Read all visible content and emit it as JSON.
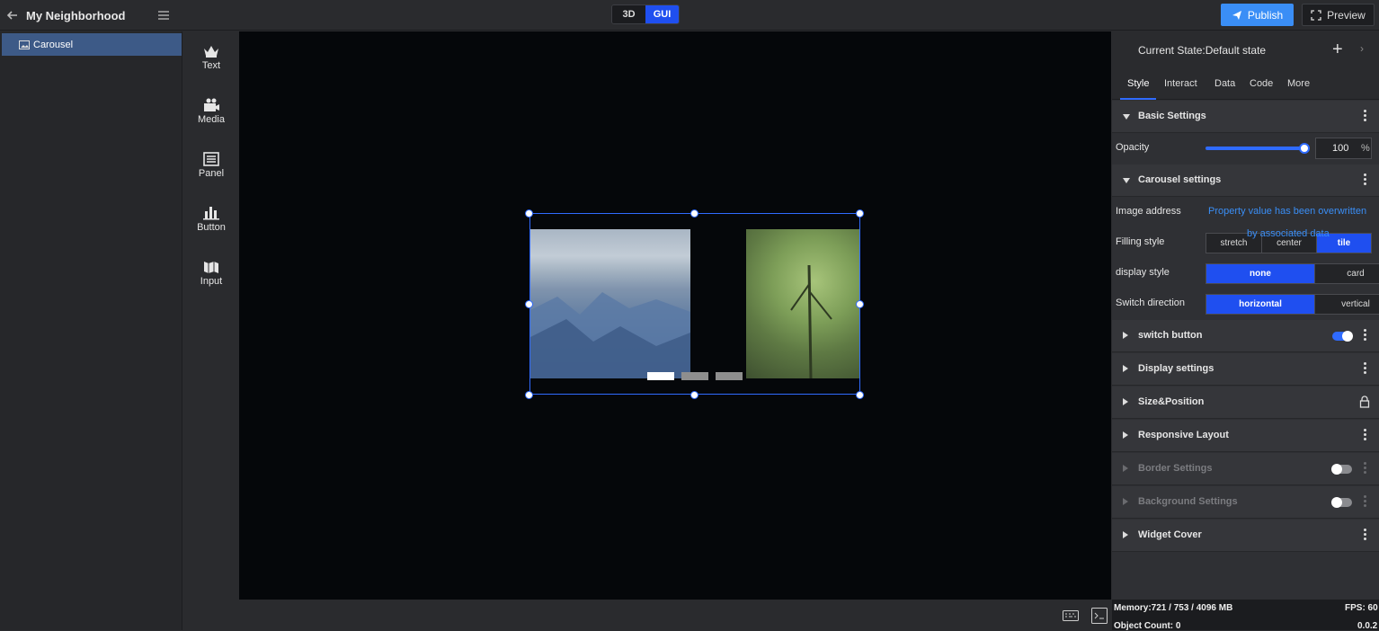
{
  "header": {
    "project_title": "My Neighborhood",
    "mode_3d": "3D",
    "mode_gui": "GUI",
    "publish_label": "Publish",
    "preview_label": "Preview"
  },
  "layers": {
    "items": [
      {
        "label": "Carousel",
        "selected": true
      }
    ]
  },
  "widgets": {
    "items": [
      {
        "label": "Text",
        "icon": "crown-icon"
      },
      {
        "label": "Media",
        "icon": "camera-icon"
      },
      {
        "label": "Panel",
        "icon": "panel-icon"
      },
      {
        "label": "Button",
        "icon": "chart-bars-icon"
      },
      {
        "label": "Input",
        "icon": "map-icon"
      }
    ]
  },
  "canvas": {
    "carousel_indicators": 3,
    "active_indicator": 1
  },
  "props": {
    "state_label": "Current State:Default state",
    "tabs": [
      "Style",
      "Interact",
      "Data",
      "Code",
      "More"
    ],
    "active_tab": "Style",
    "basic_settings": {
      "title": "Basic Settings",
      "opacity_label": "Opacity",
      "opacity_value": "100",
      "opacity_unit": "%",
      "opacity_fraction": 1.0
    },
    "carousel_settings": {
      "title": "Carousel settings",
      "image_address_label": "Image address",
      "image_address_note_1": "Property value has been overwritten",
      "image_address_note_2": "by associated data",
      "filling_style_label": "Filling style",
      "filling_options": [
        "stretch",
        "center",
        "tile"
      ],
      "filling_selected": "tile",
      "display_style_label": "display style",
      "display_options": [
        "none",
        "card"
      ],
      "display_selected": "none",
      "switch_direction_label": "Switch direction",
      "direction_options": [
        "horizontal",
        "vertical"
      ],
      "direction_selected": "horizontal"
    },
    "sections": {
      "switch_button": "switch button",
      "display_settings": "Display settings",
      "size_position": "Size&Position",
      "responsive_layout": "Responsive Layout",
      "border_settings": "Border Settings",
      "background_settings": "Background Settings",
      "widget_cover": "Widget Cover"
    }
  },
  "status": {
    "memory": "Memory:721 / 753 / 4096 MB",
    "fps": "FPS: 60",
    "object_count": "Object Count: 0",
    "version": "0.0.2"
  },
  "colors": {
    "accent": "#2f6bff",
    "publish": "#3a8ef6",
    "layer_selected": "#3d5a87",
    "canvas_bg": "#05070a"
  }
}
